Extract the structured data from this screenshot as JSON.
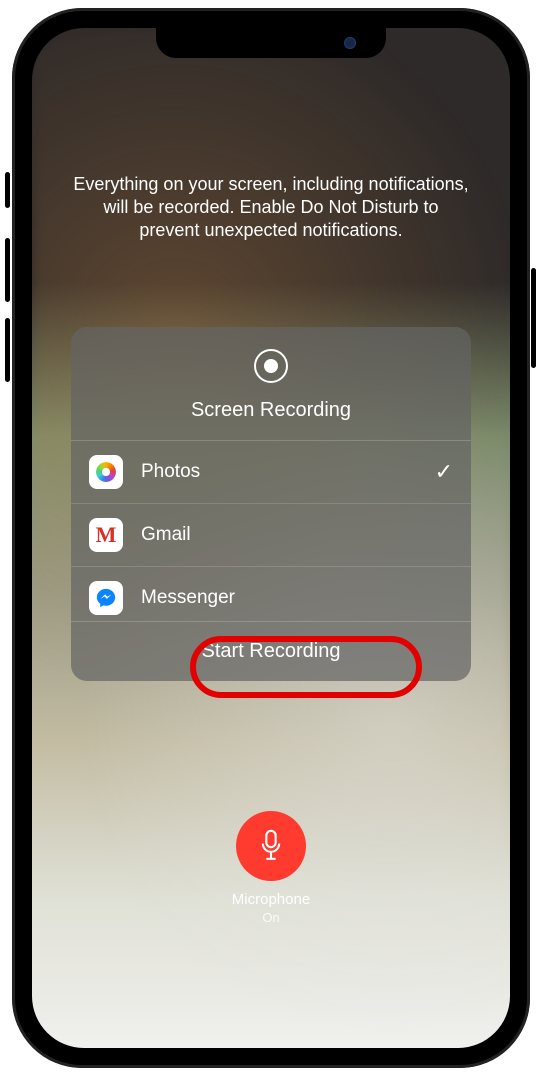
{
  "info_text": "Everything on your screen, including notifications, will be recorded. Enable Do Not Disturb to prevent unexpected notifications.",
  "sheet": {
    "title": "Screen Recording",
    "apps": [
      {
        "name": "Photos",
        "selected": true
      },
      {
        "name": "Gmail",
        "selected": false
      },
      {
        "name": "Messenger",
        "selected": false
      }
    ],
    "startLabel": "Start Recording"
  },
  "microphone": {
    "label": "Microphone",
    "status": "On"
  }
}
